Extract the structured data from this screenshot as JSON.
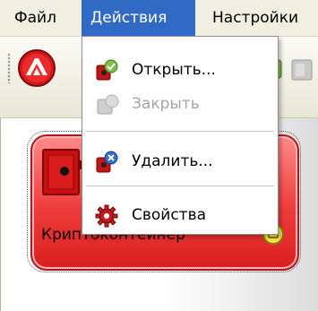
{
  "menubar": {
    "items": [
      "Файл",
      "Действия",
      "Настройки"
    ],
    "active_index": 1
  },
  "dropdown": {
    "items": [
      {
        "label": "Открыть...",
        "icon": "open-icon",
        "enabled": true
      },
      {
        "label": "Закрыть",
        "icon": "close-icon",
        "enabled": false
      },
      {
        "label": "Удалить...",
        "icon": "delete-icon",
        "enabled": true
      },
      {
        "label": "Свойства",
        "icon": "properties-gear-icon",
        "enabled": true
      }
    ]
  },
  "content": {
    "container_label": "Криптоконтейнер"
  },
  "colors": {
    "menu_highlight": "#316ac5",
    "tile_red": "#ef3b3b",
    "disabled_text": "#a6a6a6"
  }
}
